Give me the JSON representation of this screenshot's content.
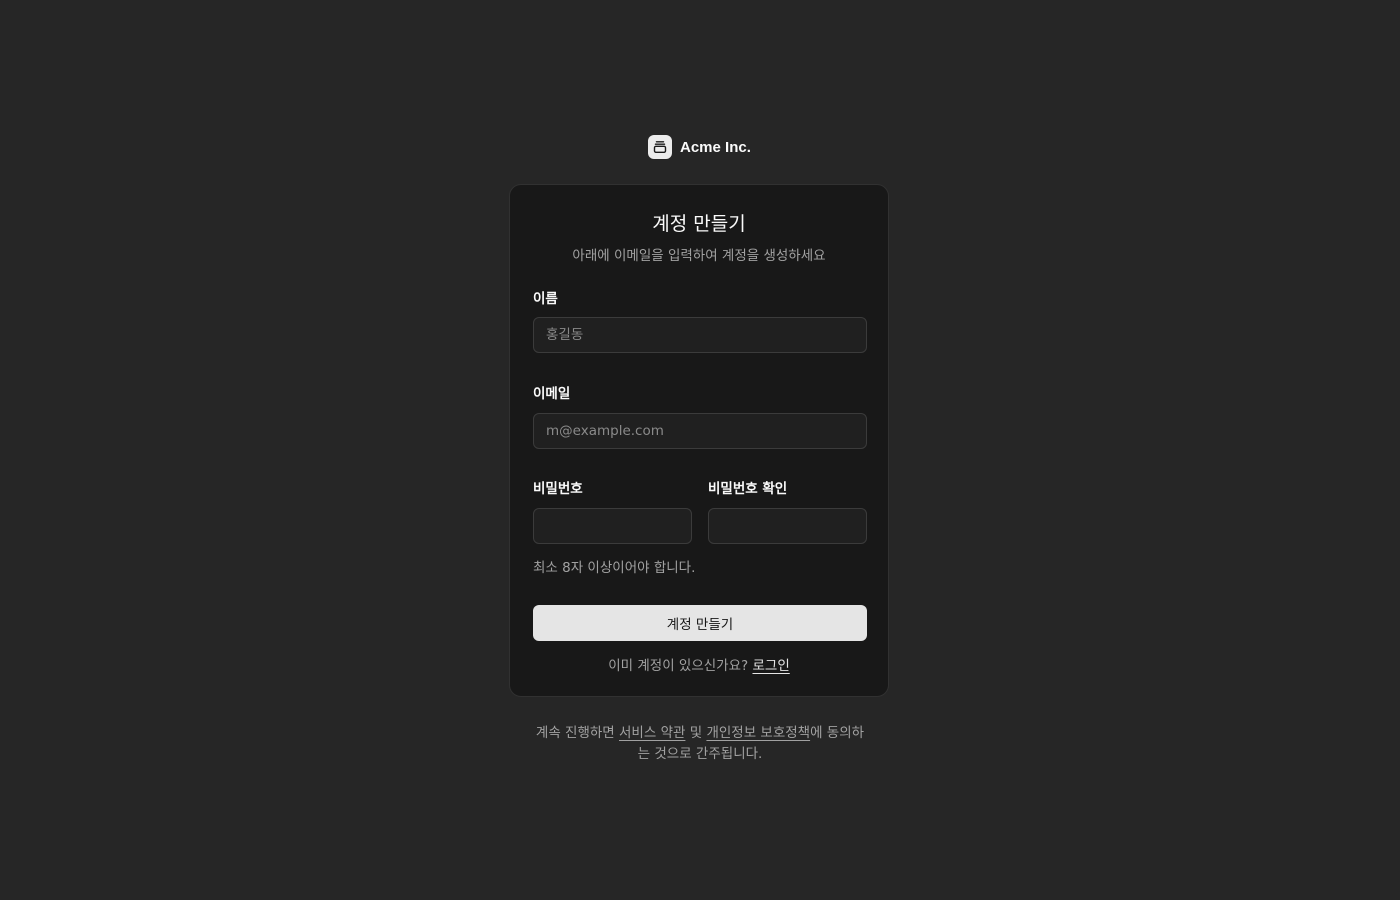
{
  "brand": {
    "name": "Acme Inc.",
    "icon": "gallery-stack-icon"
  },
  "form": {
    "title": "계정 만들기",
    "description": "아래에 이메일을 입력하여 계정을 생성하세요",
    "name_label": "이름",
    "name_placeholder": "홍길동",
    "name_value": "",
    "email_label": "이메일",
    "email_placeholder": "m@example.com",
    "email_value": "",
    "password_label": "비밀번호",
    "password_value": "",
    "confirm_password_label": "비밀번호 확인",
    "confirm_password_value": "",
    "password_hint": "최소 8자 이상이어야 합니다.",
    "submit_label": "계정 만들기",
    "login_prompt": "이미 계정이 있으신가요?",
    "login_link": "로그인"
  },
  "footer": {
    "prefix": "계속 진행하면 ",
    "terms_link": "서비스 약관",
    "and_text": " 및 ",
    "privacy_link": "개인정보 보호정책",
    "suffix": "에 동의하는 것으로 간주됩니다."
  },
  "colors": {
    "background": "#262626",
    "card": "#181818",
    "button": "#e5e5e5"
  }
}
